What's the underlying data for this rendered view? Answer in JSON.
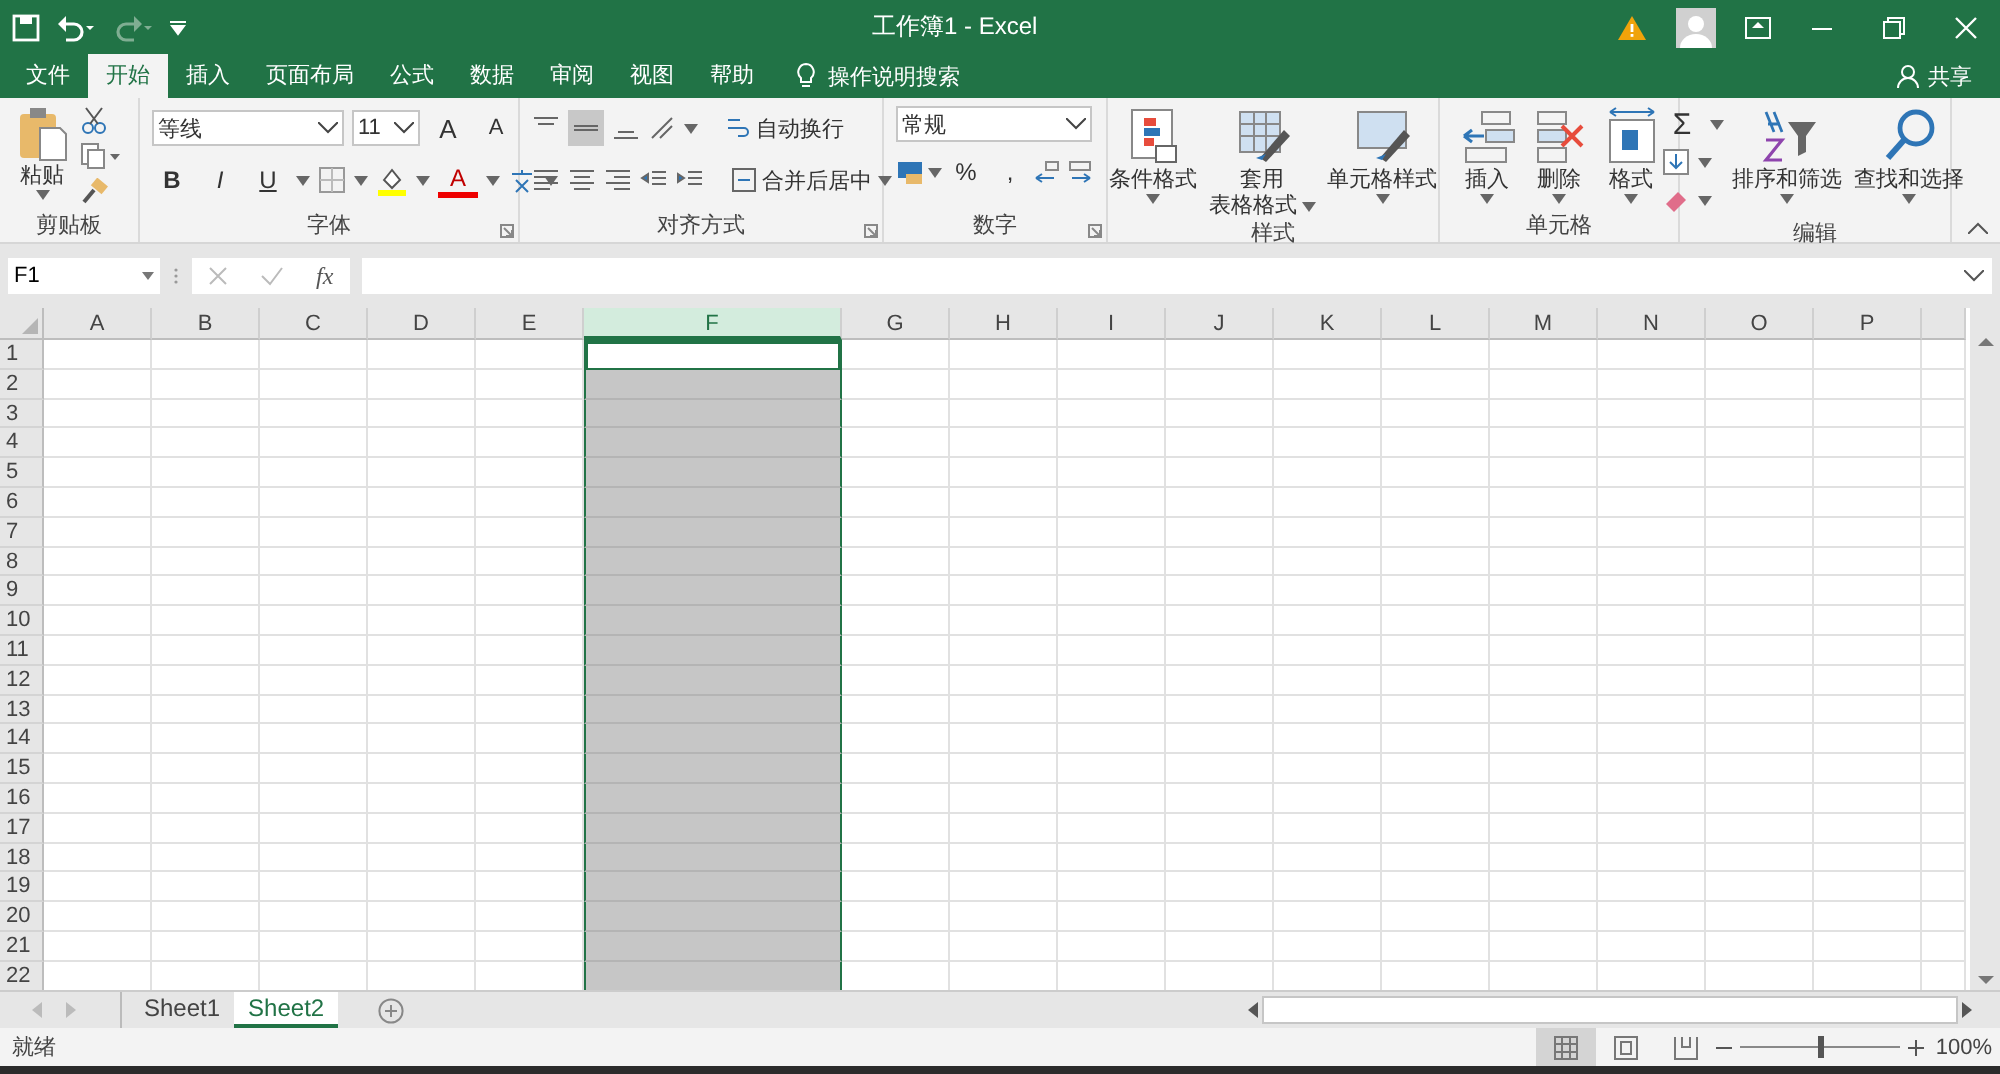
{
  "window": {
    "title": "工作簿1 - Excel"
  },
  "ribbon_tabs": [
    {
      "label": "文件",
      "selected": false
    },
    {
      "label": "开始",
      "selected": true
    },
    {
      "label": "插入",
      "selected": false
    },
    {
      "label": "页面布局",
      "selected": false
    },
    {
      "label": "公式",
      "selected": false
    },
    {
      "label": "数据",
      "selected": false
    },
    {
      "label": "审阅",
      "selected": false
    },
    {
      "label": "视图",
      "selected": false
    },
    {
      "label": "帮助",
      "selected": false
    }
  ],
  "tell_me": "操作说明搜索",
  "share": "共享",
  "ribbon": {
    "groups": [
      {
        "kind": "clipboard",
        "label": "剪贴板",
        "paste": "粘贴"
      },
      {
        "kind": "font",
        "label": "字体",
        "font_name": "等线",
        "font_size": "11",
        "grow": "A",
        "shrink": "A",
        "bold": "B",
        "italic": "I",
        "underline": "U",
        "font_color": "A"
      },
      {
        "kind": "alignment",
        "label": "对齐方式",
        "wrap_text": "自动换行",
        "merge_center": "合并后居中"
      },
      {
        "kind": "number",
        "label": "数字",
        "format": "常规",
        "percent": "%",
        "comma": ","
      },
      {
        "kind": "large",
        "label": "样式",
        "buttons": [
          {
            "label": "条件格式",
            "dropdown": true
          },
          {
            "label": "套用",
            "label_2": "表格格式",
            "dropdown": true
          },
          {
            "label": "单元格样式",
            "dropdown": true
          }
        ]
      },
      {
        "kind": "large",
        "label": "单元格",
        "buttons": [
          {
            "label": "插入",
            "dropdown": true
          },
          {
            "label": "删除",
            "dropdown": true
          },
          {
            "label": "格式",
            "dropdown": true
          }
        ]
      },
      {
        "kind": "editing",
        "label": "编辑",
        "sum": "Σ",
        "buttons": [
          {
            "label": "排序和筛选",
            "dropdown": true
          },
          {
            "label": "查找和选择",
            "dropdown": true
          }
        ]
      }
    ]
  },
  "formula_bar": {
    "name_box": "F1",
    "function_label": "fx"
  },
  "sheet": {
    "columns": [
      {
        "label": "A",
        "selected": false
      },
      {
        "label": "B",
        "selected": false
      },
      {
        "label": "C",
        "selected": false
      },
      {
        "label": "D",
        "selected": false
      },
      {
        "label": "E",
        "selected": false
      },
      {
        "label": "F",
        "selected": true
      },
      {
        "label": "G",
        "selected": false
      },
      {
        "label": "H",
        "selected": false
      },
      {
        "label": "I",
        "selected": false
      },
      {
        "label": "J",
        "selected": false
      },
      {
        "label": "K",
        "selected": false
      },
      {
        "label": "L",
        "selected": false
      },
      {
        "label": "M",
        "selected": false
      },
      {
        "label": "N",
        "selected": false
      },
      {
        "label": "O",
        "selected": false
      },
      {
        "label": "P",
        "selected": false
      }
    ],
    "rows": [
      "1",
      "2",
      "3",
      "4",
      "5",
      "6",
      "7",
      "8",
      "9",
      "10",
      "11",
      "12",
      "13",
      "14",
      "15",
      "16",
      "17",
      "18",
      "19",
      "20",
      "21",
      "22"
    ]
  },
  "sheet_tabs": [
    {
      "label": "Sheet1",
      "selected": false
    },
    {
      "label": "Sheet2",
      "selected": true
    }
  ],
  "status_bar": {
    "status": "就绪",
    "zoom": "100%",
    "level": 0.5
  }
}
